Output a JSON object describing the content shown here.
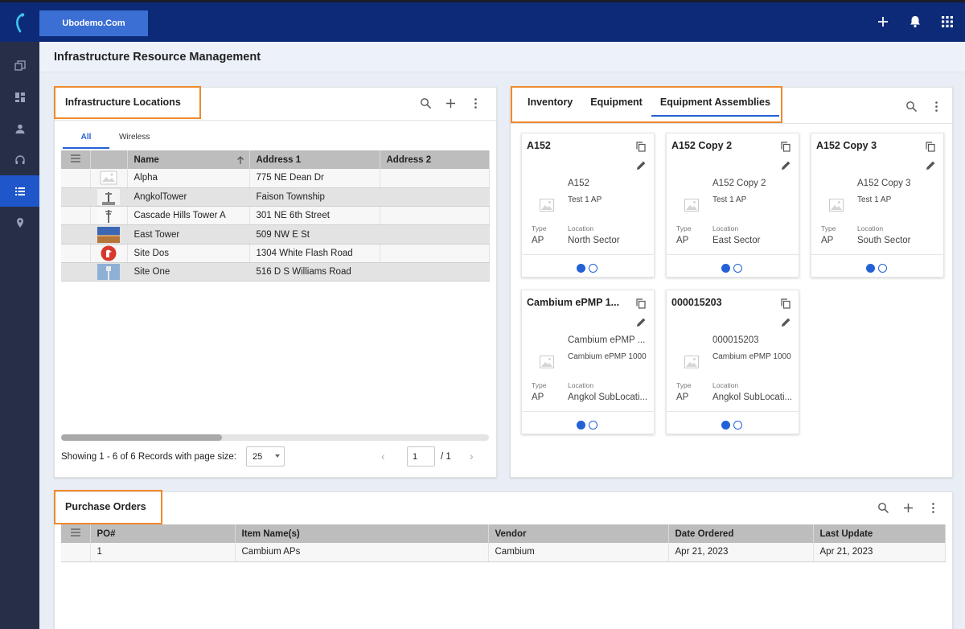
{
  "header": {
    "org_name": "Ubodemo.Com",
    "icons": [
      "plus-icon",
      "bell-icon",
      "apps-grid-icon"
    ]
  },
  "sidebar": {
    "items": [
      {
        "icon": "layers-icon",
        "active": false
      },
      {
        "icon": "dashboard-icon",
        "active": false
      },
      {
        "icon": "person-icon",
        "active": false
      },
      {
        "icon": "headset-icon",
        "active": false
      },
      {
        "icon": "list-icon",
        "active": true
      },
      {
        "icon": "location-pin-icon",
        "active": false
      }
    ]
  },
  "page": {
    "title": "Infrastructure Resource Management"
  },
  "locations": {
    "title": "Infrastructure Locations",
    "tabs": [
      "All",
      "Wireless"
    ],
    "active_tab": "All",
    "columns": [
      "Name",
      "Address 1",
      "Address 2"
    ],
    "rows": [
      {
        "name": "Alpha",
        "address1": "775 NE Dean Dr",
        "address2": "",
        "thumb": "placeholder"
      },
      {
        "name": "AngkolTower",
        "address1": "Faison Township",
        "address2": "",
        "thumb": "tower"
      },
      {
        "name": "Cascade Hills Tower A",
        "address1": "301 NE 6th Street",
        "address2": "",
        "thumb": "antenna"
      },
      {
        "name": "East Tower",
        "address1": "509 NW E St",
        "address2": "",
        "thumb": "landscape"
      },
      {
        "name": "Site Dos",
        "address1": "1304 White Flash Road",
        "address2": "",
        "thumb": "red-logo"
      },
      {
        "name": "Site One",
        "address1": "516 D S Williams Road",
        "address2": "",
        "thumb": "water-tower"
      }
    ],
    "pager": {
      "summary": "Showing 1 - 6 of 6 Records with page size:",
      "page_size": "25",
      "current_page": "1",
      "total_pages": "/ 1"
    }
  },
  "equipment": {
    "tabs": [
      "Inventory",
      "Equipment",
      "Equipment Assemblies"
    ],
    "active_tab": "Equipment Assemblies",
    "type_label": "Type",
    "location_label": "Location",
    "cards": [
      {
        "title": "A152",
        "name": "A152",
        "desc": "Test 1 AP",
        "type": "AP",
        "location": "North Sector"
      },
      {
        "title": "A152 Copy 2",
        "name": "A152 Copy 2",
        "desc": "Test 1 AP",
        "type": "AP",
        "location": "East Sector"
      },
      {
        "title": "A152 Copy 3",
        "name": "A152 Copy 3",
        "desc": "Test 1 AP",
        "type": "AP",
        "location": "South Sector"
      },
      {
        "title": "Cambium ePMP 1...",
        "name": "Cambium ePMP ...",
        "desc": "Cambium ePMP 1000",
        "type": "AP",
        "location": "Angkol SubLocati..."
      },
      {
        "title": "000015203",
        "name": "000015203",
        "desc": "Cambium ePMP 1000",
        "type": "AP",
        "location": "Angkol SubLocati..."
      }
    ]
  },
  "purchase_orders": {
    "title": "Purchase Orders",
    "columns": [
      "PO#",
      "Item Name(s)",
      "Vendor",
      "Date Ordered",
      "Last Update"
    ],
    "rows": [
      {
        "po": "1",
        "items": "Cambium APs",
        "vendor": "Cambium",
        "date_ordered": "Apr 21, 2023",
        "last_update": "Apr 21, 2023"
      }
    ]
  },
  "colors": {
    "topbar": "#0d2a78",
    "sidebar": "#272f48",
    "accent": "#2461d6",
    "highlight": "#f0892d"
  }
}
